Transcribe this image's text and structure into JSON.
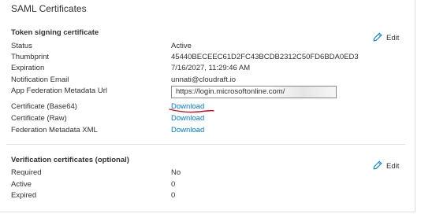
{
  "card": {
    "title": "SAML Certificates"
  },
  "token_signing": {
    "heading": "Token signing certificate",
    "edit_label": "Edit",
    "rows": {
      "status": {
        "label": "Status",
        "value": "Active"
      },
      "thumbprint": {
        "label": "Thumbprint",
        "value": "45440BECEEC61D2FC43BCDB2312C50FD6BDA0ED3"
      },
      "expiration": {
        "label": "Expiration",
        "value": "7/16/2027, 11:29:46 AM"
      },
      "notification_email": {
        "label": "Notification Email",
        "value": "unnati@cloudraft.io"
      },
      "metadata_url": {
        "label": "App Federation Metadata Url",
        "value": "https://login.microsoftonline.com/"
      },
      "cert_base64": {
        "label": "Certificate (Base64)",
        "value": "Download"
      },
      "cert_raw": {
        "label": "Certificate (Raw)",
        "value": "Download"
      },
      "federation_xml": {
        "label": "Federation Metadata XML",
        "value": "Download"
      }
    }
  },
  "verification": {
    "heading": "Verification certificates (optional)",
    "edit_label": "Edit",
    "rows": {
      "required": {
        "label": "Required",
        "value": "No"
      },
      "active": {
        "label": "Active",
        "value": "0"
      },
      "expired": {
        "label": "Expired",
        "value": "0"
      }
    }
  },
  "colors": {
    "link": "#0078d4",
    "annotation": "#c50f1f",
    "text": "#323130",
    "border": "#e1dfdd"
  },
  "icons": {
    "edit": "pencil-icon"
  }
}
